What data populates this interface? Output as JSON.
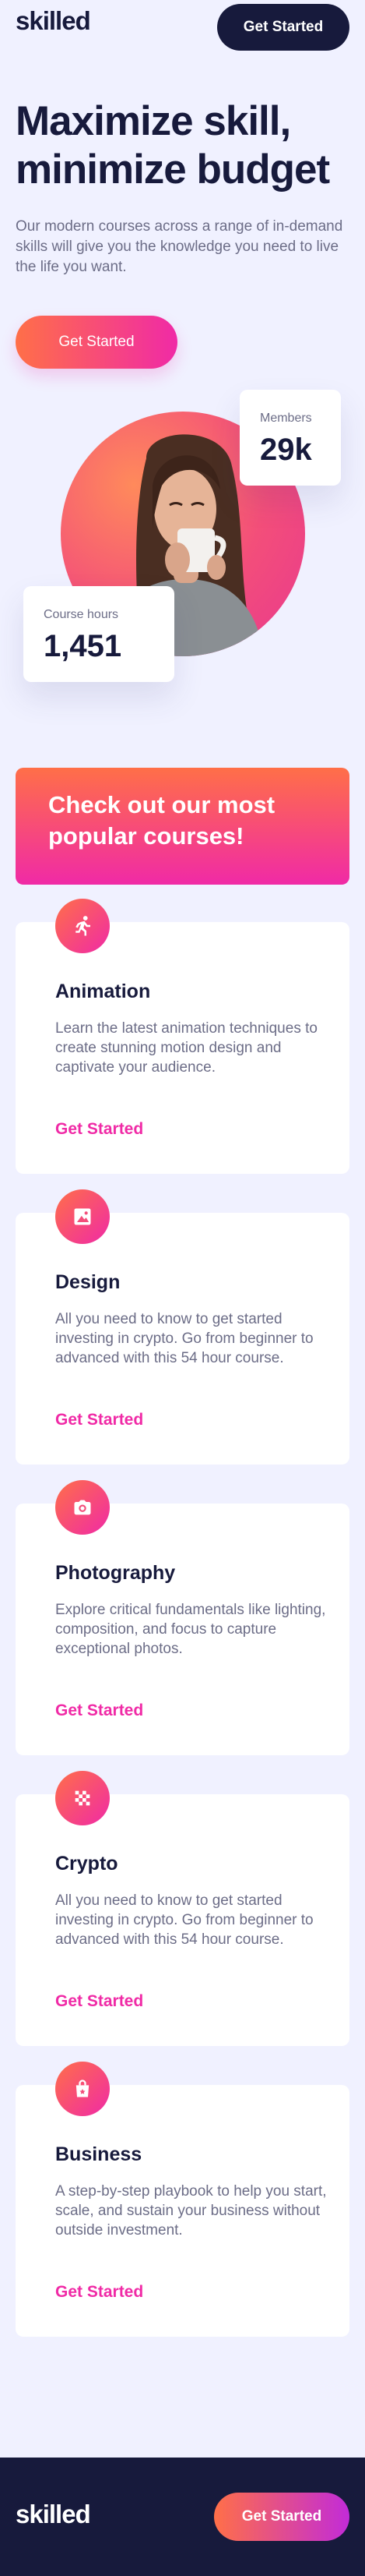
{
  "header": {
    "logo": "skilled",
    "cta_label": "Get Started"
  },
  "hero": {
    "title": "Maximize skill, minimize budget",
    "description": "Our modern courses across a range of in-demand skills will give you the knowledge you need to live the life you want.",
    "cta_label": "Get Started",
    "stats": {
      "members_label": "Members",
      "members_value": "29k",
      "hours_label": "Course hours",
      "hours_value": "1,451"
    }
  },
  "popular": {
    "title": "Check out our most popular courses!"
  },
  "courses": [
    {
      "title": "Animation",
      "description": "Learn the latest animation techniques to create stunning motion design and captivate your audience.",
      "link": "Get Started",
      "icon": "running-person-icon"
    },
    {
      "title": "Design",
      "description": "All you need to know to get started investing in crypto. Go from beginner to advanced with this 54 hour course.",
      "link": "Get Started",
      "icon": "picture-icon"
    },
    {
      "title": "Photography",
      "description": "Explore critical fundamentals like lighting, composition, and focus to capture exceptional photos.",
      "link": "Get Started",
      "icon": "camera-icon"
    },
    {
      "title": "Crypto",
      "description": "All you need to know to get started investing in crypto. Go from beginner to advanced with this 54 hour course.",
      "link": "Get Started",
      "icon": "crypto-icon"
    },
    {
      "title": "Business",
      "description": "A step-by-step playbook to help you start, scale, and sustain your business without outside investment.",
      "link": "Get Started",
      "icon": "shopping-bag-icon"
    }
  ],
  "footer": {
    "logo": "skilled",
    "cta_label": "Get Started"
  },
  "colors": {
    "navy": "#171a3c",
    "background": "#f0f1ff",
    "gradient_start": "#ff6f48",
    "gradient_end": "#f02aa6",
    "text_muted": "#6c6d87"
  }
}
